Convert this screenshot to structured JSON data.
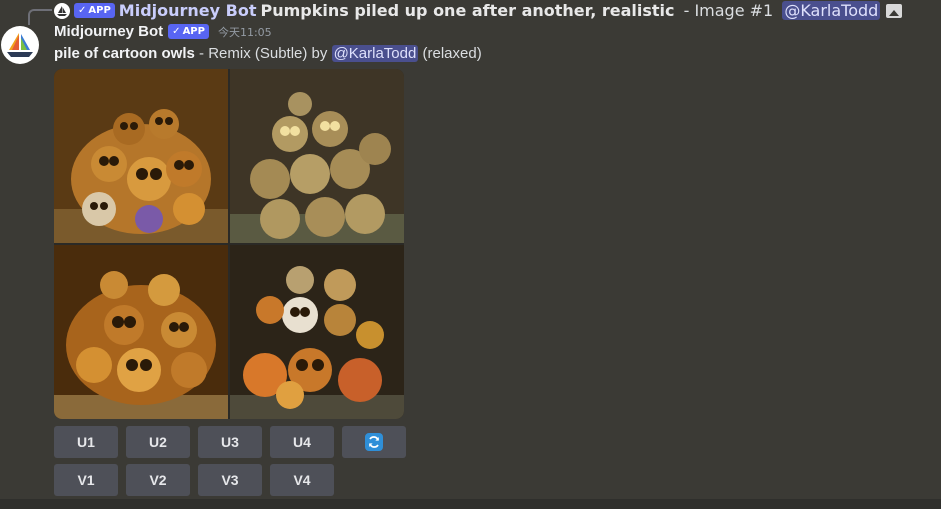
{
  "reply": {
    "author": "Midjourney Bot",
    "badge": "APP",
    "prompt": "Pumpkins piled up one after another, realistic",
    "suffix": " - Image #1 ",
    "mention": "@KarlaTodd"
  },
  "message": {
    "author": "Midjourney Bot",
    "badge": "APP",
    "timestamp": "今天11:05",
    "prompt": "pile of cartoon owls",
    "mode_text": " - Remix (Subtle) by ",
    "mention": "@KarlaTodd",
    "speed": " (relaxed)"
  },
  "images": [
    {
      "name": "owls-image-1"
    },
    {
      "name": "owls-image-2"
    },
    {
      "name": "owls-image-3"
    },
    {
      "name": "owls-image-4"
    }
  ],
  "buttons": {
    "upscale": [
      "U1",
      "U2",
      "U3",
      "U4"
    ],
    "variation": [
      "V1",
      "V2",
      "V3",
      "V4"
    ],
    "reroll_icon": "reroll-icon"
  },
  "colors": {
    "background": "#3b3a35",
    "badge": "#5865f2",
    "mention_bg": "#4a4f8e",
    "button": "#4e5058",
    "reroll": "#2f8fd8"
  }
}
